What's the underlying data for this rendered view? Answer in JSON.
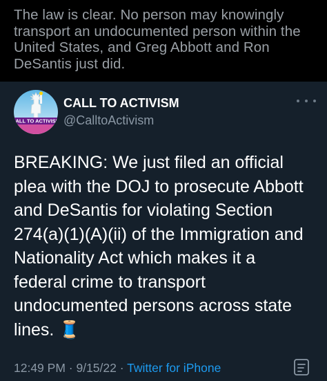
{
  "quote": {
    "text": "The law is clear. No person may knowingly\ntransport an undocumented person within the\nUnited States, and Greg Abbott and Ron\nDeSantis just did."
  },
  "tweet": {
    "author": {
      "display_name": "CALL TO ACTIVISM",
      "handle": "@CalltoActivism",
      "avatar_text": "CALL TO ACTIVISM"
    },
    "body": "BREAKING: We just filed an official\nplea with the DOJ to prosecute Abbott\nand DeSantis for violating Section\n274(a)(1)(A)(ii) of the Immigration and\nNationality Act which makes it a\nfederal crime to transport\nundocumented persons across state\nlines. 🧵",
    "time": "12:49 PM",
    "separator": "·",
    "date": "9/15/22",
    "source": "Twitter for iPhone",
    "icons": {
      "more": "more-options-icon",
      "analytics": "tweet-analytics-icon",
      "thread": "spool-of-thread-emoji"
    }
  },
  "colors": {
    "background": "#15202b",
    "quote_background": "#000000",
    "link": "#1d9bf0",
    "secondary_text": "#8b98a5"
  }
}
